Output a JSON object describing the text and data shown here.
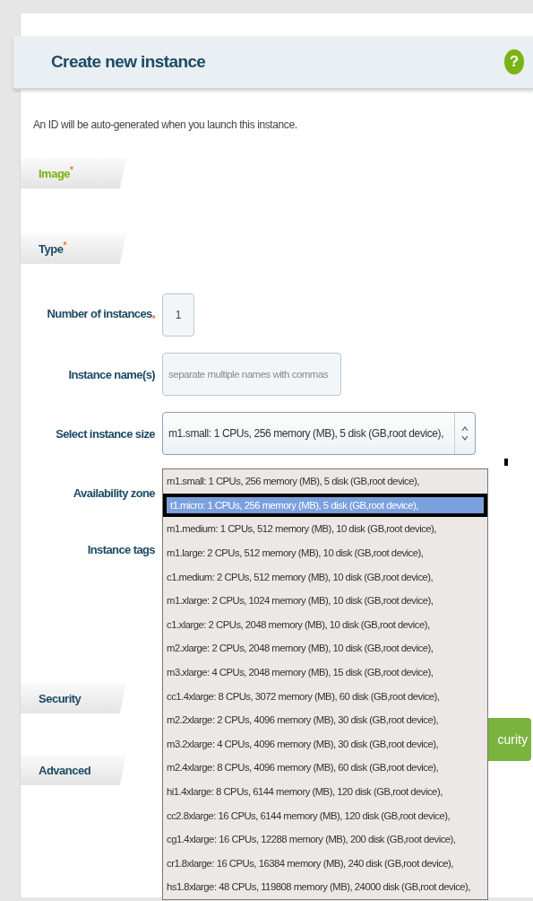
{
  "panel": {
    "title": "Create new instance",
    "help": "?"
  },
  "description": "An ID will be auto-generated when you launch this instance.",
  "sections": [
    {
      "label": "Image",
      "required_mark": "*",
      "valid": true
    },
    {
      "label": "Type",
      "required_mark": "*",
      "valid": false,
      "fields": [
        {
          "kind": "number",
          "label": "Number of instances",
          "required_mark": "*",
          "value": "1"
        },
        {
          "kind": "text",
          "label": "Instance name(s)",
          "placeholder": "separate multiple names with commas"
        },
        {
          "kind": "select",
          "label": "Select instance size",
          "value": "m1.small: 1 CPUs, 256 memory (MB), 5 disk (GB,root device),",
          "expanded": true
        },
        {
          "kind": "label",
          "label": "Availability zone"
        },
        {
          "kind": "tags",
          "label": "Instance tags"
        }
      ]
    },
    {
      "label": "Security",
      "valid": false
    },
    {
      "label": "Advanced",
      "valid": false
    }
  ],
  "next_button": "curity",
  "dropdown": [
    {
      "label": "m1.small: 1 CPUs, 256 memory (MB), 5 disk (GB,root device),",
      "selected": false
    },
    {
      "label": "t1.micro: 1 CPUs, 256 memory (MB), 5 disk (GB,root device),",
      "selected": true
    },
    {
      "label": "m1.medium: 1 CPUs, 512 memory (MB), 10 disk (GB,root device),",
      "selected": false
    },
    {
      "label": "m1.large: 2 CPUs, 512 memory (MB), 10 disk (GB,root device),",
      "selected": false
    },
    {
      "label": "c1.medium: 2 CPUs, 512 memory (MB), 10 disk (GB,root device),",
      "selected": false
    },
    {
      "label": "m1.xlarge: 2 CPUs, 1024 memory (MB), 10 disk (GB,root device),",
      "selected": false
    },
    {
      "label": "c1.xlarge: 2 CPUs, 2048 memory (MB), 10 disk (GB,root device),",
      "selected": false
    },
    {
      "label": "m2.xlarge: 2 CPUs, 2048 memory (MB), 10 disk (GB,root device),",
      "selected": false
    },
    {
      "label": "m3.xlarge: 4 CPUs, 2048 memory (MB), 15 disk (GB,root device),",
      "selected": false
    },
    {
      "label": "cc1.4xlarge: 8 CPUs, 3072 memory (MB), 60 disk (GB,root device),",
      "selected": false
    },
    {
      "label": "m2.2xlarge: 2 CPUs, 4096 memory (MB), 30 disk (GB,root device),",
      "selected": false
    },
    {
      "label": "m3.2xlarge: 4 CPUs, 4096 memory (MB), 30 disk (GB,root device),",
      "selected": false
    },
    {
      "label": "m2.4xlarge: 8 CPUs, 4096 memory (MB), 60 disk (GB,root device),",
      "selected": false
    },
    {
      "label": "hi1.4xlarge: 8 CPUs, 6144 memory (MB), 120 disk (GB,root device),",
      "selected": false
    },
    {
      "label": "cc2.8xlarge: 16 CPUs, 6144 memory (MB), 120 disk (GB,root device),",
      "selected": false
    },
    {
      "label": "cg1.4xlarge: 16 CPUs, 12288 memory (MB), 200 disk (GB,root device),",
      "selected": false
    },
    {
      "label": "cr1.8xlarge: 16 CPUs, 16384 memory (MB), 240 disk (GB,root device),",
      "selected": false
    },
    {
      "label": "hs1.8xlarge: 48 CPUs, 119808 memory (MB), 24000 disk (GB,root device),",
      "selected": false
    }
  ]
}
